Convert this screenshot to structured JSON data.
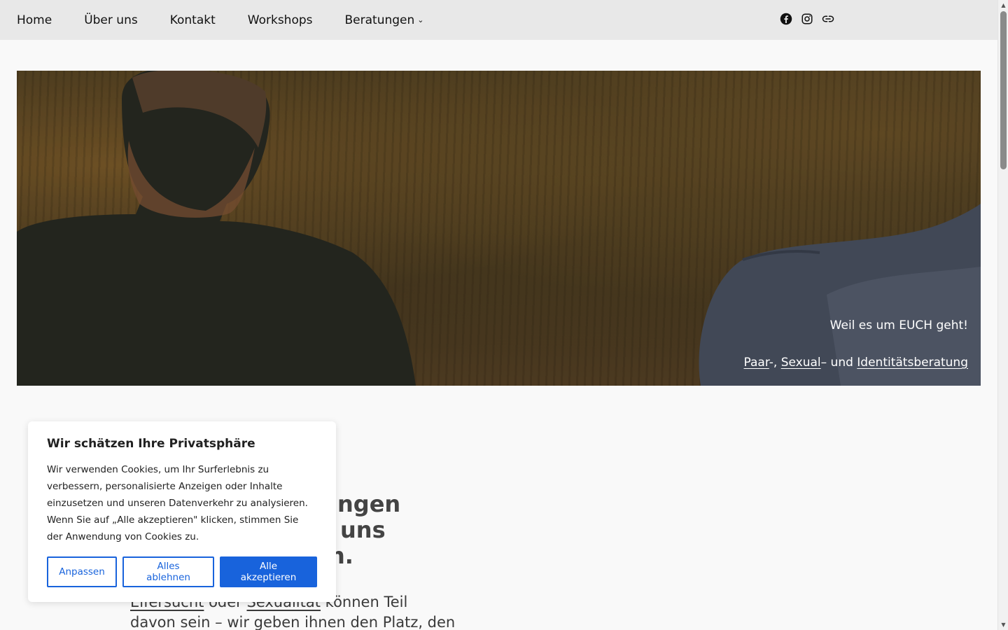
{
  "nav": {
    "items": [
      {
        "label": "Home"
      },
      {
        "label": "Über uns"
      },
      {
        "label": "Kontakt"
      },
      {
        "label": "Workshops"
      },
      {
        "label": "Beratungen",
        "has_dropdown": true
      }
    ],
    "dropdown_glyph": "⌄"
  },
  "social": {
    "icons": [
      "facebook-icon",
      "instagram-icon",
      "link-icon"
    ]
  },
  "hero": {
    "tagline": "Weil es um EUCH geht!",
    "services": {
      "link1": "Paar",
      "sep1": "-, ",
      "link2": "Sexual",
      "sep2": "– und ",
      "link3": "Identitätsberatung"
    }
  },
  "content": {
    "headline_line1": "ngen",
    "headline_line2": "uns",
    "headline_line3": "n.",
    "sub_link1": "Eifersucht",
    "sub_text1": " oder ",
    "sub_link2": "Sexualität",
    "sub_text2": " können Teil",
    "sub_line2": "davon sein – wir geben ihnen den Platz, den"
  },
  "cookie": {
    "title": "Wir schätzen Ihre Privatsphäre",
    "text": "Wir verwenden Cookies, um Ihr Surferlebnis zu verbessern, personalisierte Anzeigen oder Inhalte einzusetzen und unseren Datenverkehr zu analysieren. Wenn Sie auf „Alle akzeptieren\" klicken, stimmen Sie der Anwendung von Cookies zu.",
    "btn_customize": "Anpassen",
    "btn_reject": "Alles ablehnen",
    "btn_accept": "Alle akzeptieren"
  },
  "colors": {
    "accent": "#1863dc",
    "header_bg": "#e8e8e8",
    "page_bg": "#f9f9f9"
  }
}
